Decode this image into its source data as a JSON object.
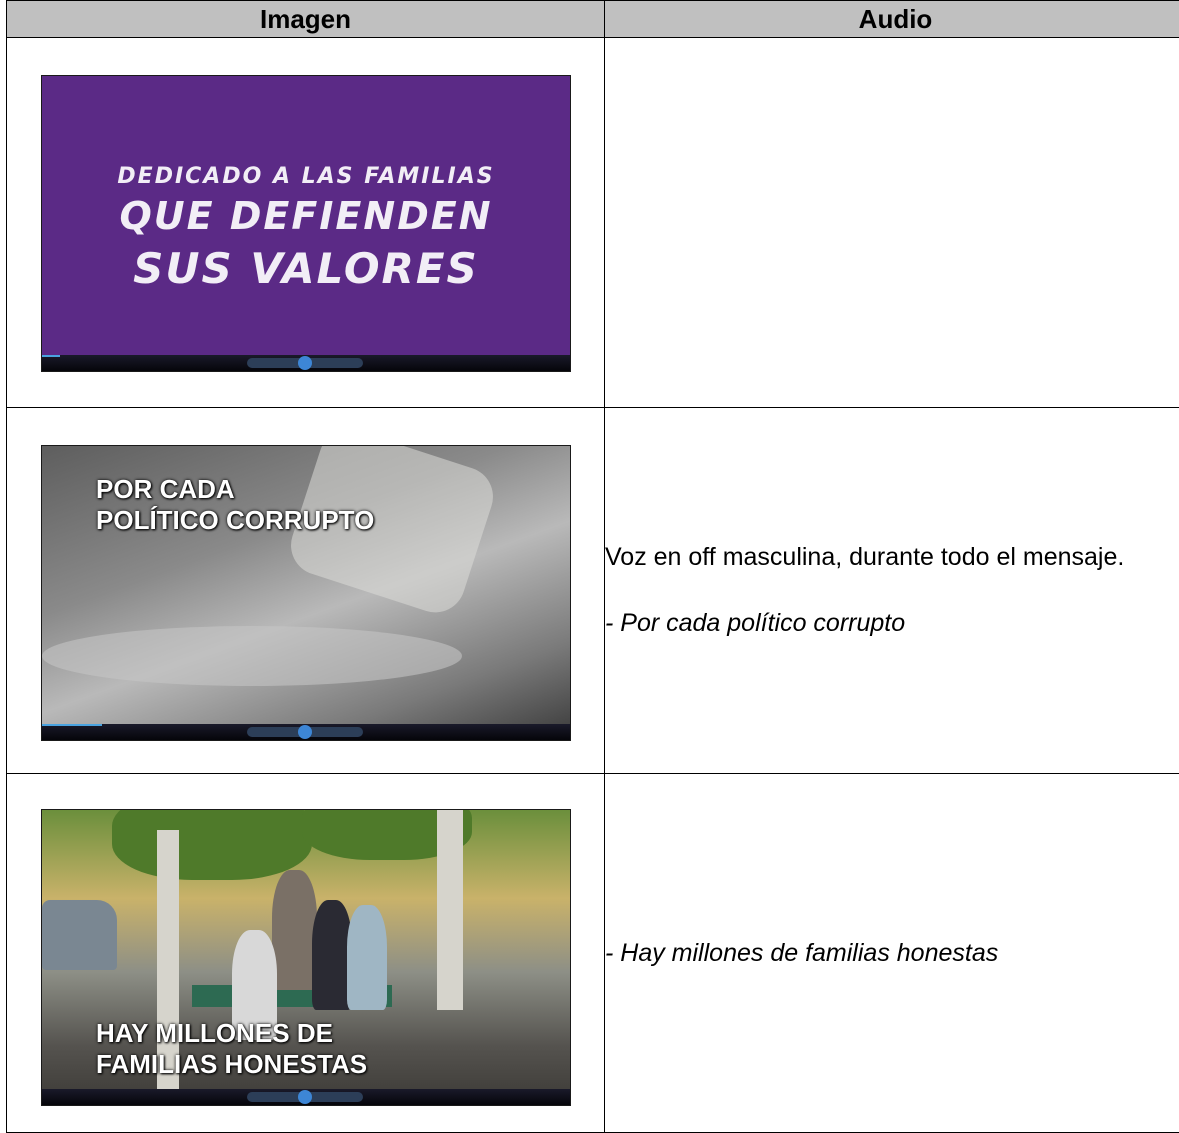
{
  "table": {
    "headers": {
      "image": "Imagen",
      "audio": "Audio"
    },
    "rows": [
      {
        "frame_text": [
          "DEDICADO A LAS FAMILIAS",
          "QUE DEFIENDEN",
          "SUS VALORES"
        ],
        "audio": []
      },
      {
        "frame_text": [
          "POR CADA",
          "POLÍTICO CORRUPTO"
        ],
        "audio": [
          "Voz en off masculina, durante todo el mensaje.",
          "- Por cada político corrupto"
        ]
      },
      {
        "frame_text": [
          "HAY MILLONES DE",
          "FAMILIAS HONESTAS"
        ],
        "audio": [
          "- Hay millones de familias honestas"
        ]
      }
    ]
  },
  "colors": {
    "frame1_bg": "#5b2a86",
    "header_bg": "#c0c0c0"
  }
}
